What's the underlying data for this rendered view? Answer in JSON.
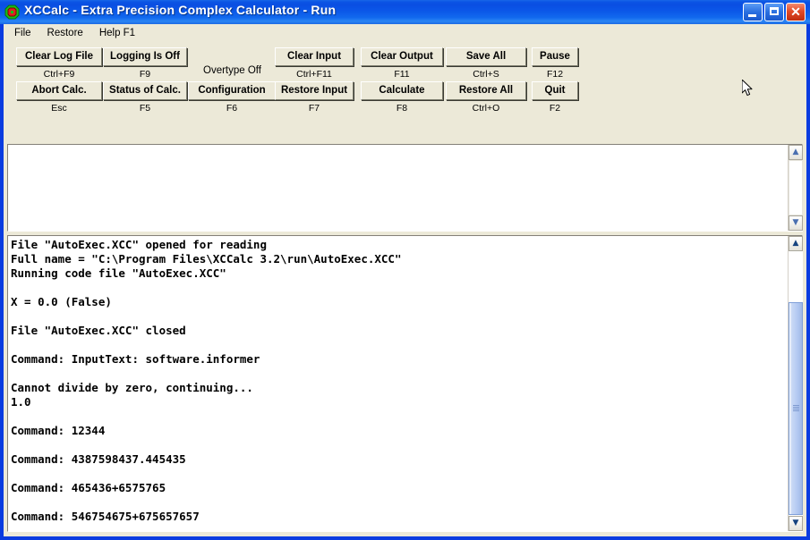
{
  "window": {
    "title": "XCCalc - Extra Precision Complex Calculator - Run",
    "icon": "app-octagon-icon",
    "controls": {
      "minimize": "_",
      "maximize": "□",
      "close": "✕"
    }
  },
  "menubar": {
    "items": [
      {
        "label": "File"
      },
      {
        "label": "Restore"
      },
      {
        "label": "Help F1"
      }
    ]
  },
  "toolbar": {
    "overtype_label": "Overtype Off",
    "row1": [
      {
        "label": "Clear Log File",
        "key": "Ctrl+F9"
      },
      {
        "label": "Logging Is Off",
        "key": "F9"
      },
      {
        "label": "Clear Input",
        "key": "Ctrl+F11"
      },
      {
        "label": "Clear Output",
        "key": "F11"
      },
      {
        "label": "Save All",
        "key": "Ctrl+S"
      },
      {
        "label": "Pause",
        "key": "F12"
      }
    ],
    "row2": [
      {
        "label": "Abort Calc.",
        "key": "Esc"
      },
      {
        "label": "Status of Calc.",
        "key": "F5"
      },
      {
        "label": "Configuration",
        "key": "F6"
      },
      {
        "label": "Restore Input",
        "key": "F7"
      },
      {
        "label": "Calculate",
        "key": "F8"
      },
      {
        "label": "Restore All",
        "key": "Ctrl+O"
      },
      {
        "label": "Quit",
        "key": "F2"
      }
    ]
  },
  "input_pane": {
    "text": ""
  },
  "output_pane": {
    "text": "File \"AutoExec.XCC\" opened for reading\nFull name = \"C:\\Program Files\\XCCalc 3.2\\run\\AutoExec.XCC\"\nRunning code file \"AutoExec.XCC\"\n\nX = 0.0 (False)\n\nFile \"AutoExec.XCC\" closed\n\nCommand: InputText: software.informer\n\nCannot divide by zero, continuing...\n1.0\n\nCommand: 12344\n\nCommand: 4387598437.445435\n\nCommand: 465436+6575765\n\nCommand: 546754675+675657657\n"
  },
  "scrollbars": {
    "up_arrow": "▲",
    "down_arrow": "▼"
  },
  "colors": {
    "titlebar_blue": "#0a4ee2",
    "client_beige": "#ece9d8",
    "close_red": "#e24b27",
    "thumb_blue": "#b5caf2"
  }
}
